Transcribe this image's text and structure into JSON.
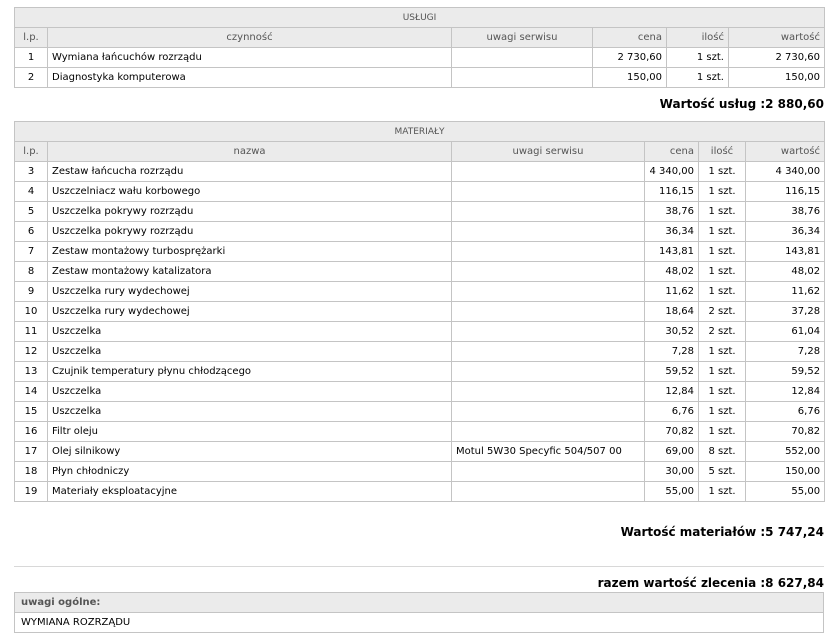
{
  "services": {
    "caption": "USŁUGI",
    "headers": [
      "l.p.",
      "czynność",
      "uwagi serwisu",
      "cena",
      "ilość",
      "wartość"
    ],
    "rows": [
      {
        "lp": "1",
        "name": "Wymiana łańcuchów rozrządu",
        "note": "",
        "price": "2 730,60",
        "qty": "1 szt.",
        "value": "2 730,60"
      },
      {
        "lp": "2",
        "name": "Diagnostyka komputerowa",
        "note": "",
        "price": "150,00",
        "qty": "1 szt.",
        "value": "150,00"
      }
    ],
    "total": "Wartość usług :2 880,60"
  },
  "materials": {
    "caption": "MATERIAŁY",
    "headers": [
      "l.p.",
      "nazwa",
      "uwagi serwisu",
      "cena",
      "ilość",
      "wartość"
    ],
    "rows": [
      {
        "lp": "3",
        "name": "Zestaw łańcucha rozrządu",
        "note": "",
        "price": "4 340,00",
        "qty": "1 szt.",
        "value": "4 340,00"
      },
      {
        "lp": "4",
        "name": "Uszczelniacz wału korbowego",
        "note": "",
        "price": "116,15",
        "qty": "1 szt.",
        "value": "116,15"
      },
      {
        "lp": "5",
        "name": "Uszczelka pokrywy rozrządu",
        "note": "",
        "price": "38,76",
        "qty": "1 szt.",
        "value": "38,76"
      },
      {
        "lp": "6",
        "name": "Uszczelka pokrywy rozrządu",
        "note": "",
        "price": "36,34",
        "qty": "1 szt.",
        "value": "36,34"
      },
      {
        "lp": "7",
        "name": "Zestaw montażowy turbosprężarki",
        "note": "",
        "price": "143,81",
        "qty": "1 szt.",
        "value": "143,81"
      },
      {
        "lp": "8",
        "name": "Zestaw montażowy katalizatora",
        "note": "",
        "price": "48,02",
        "qty": "1 szt.",
        "value": "48,02"
      },
      {
        "lp": "9",
        "name": "Uszczelka rury wydechowej",
        "note": "",
        "price": "11,62",
        "qty": "1 szt.",
        "value": "11,62"
      },
      {
        "lp": "10",
        "name": "Uszczelka rury wydechowej",
        "note": "",
        "price": "18,64",
        "qty": "2 szt.",
        "value": "37,28"
      },
      {
        "lp": "11",
        "name": "Uszczelka",
        "note": "",
        "price": "30,52",
        "qty": "2 szt.",
        "value": "61,04"
      },
      {
        "lp": "12",
        "name": "Uszczelka",
        "note": "",
        "price": "7,28",
        "qty": "1 szt.",
        "value": "7,28"
      },
      {
        "lp": "13",
        "name": "Czujnik temperatury płynu chłodzącego",
        "note": "",
        "price": "59,52",
        "qty": "1 szt.",
        "value": "59,52"
      },
      {
        "lp": "14",
        "name": "Uszczelka",
        "note": "",
        "price": "12,84",
        "qty": "1 szt.",
        "value": "12,84"
      },
      {
        "lp": "15",
        "name": "Uszczelka",
        "note": "",
        "price": "6,76",
        "qty": "1 szt.",
        "value": "6,76"
      },
      {
        "lp": "16",
        "name": "Filtr oleju",
        "note": "",
        "price": "70,82",
        "qty": "1 szt.",
        "value": "70,82"
      },
      {
        "lp": "17",
        "name": "Olej silnikowy",
        "note": "Motul 5W30 Specyfic 504/507 00",
        "price": "69,00",
        "qty": "8 szt.",
        "value": "552,00"
      },
      {
        "lp": "18",
        "name": "Płyn chłodniczy",
        "note": "",
        "price": "30,00",
        "qty": "5 szt.",
        "value": "150,00"
      },
      {
        "lp": "19",
        "name": "Materiały eksploatacyjne",
        "note": "",
        "price": "55,00",
        "qty": "1 szt.",
        "value": "55,00"
      }
    ],
    "total": "Wartość materiałów :5 747,24"
  },
  "grand_total": "razem wartość zlecenia :8 627,84",
  "notes": {
    "label": "uwagi ogólne:",
    "text": "WYMIANA ROZRZĄDU"
  }
}
